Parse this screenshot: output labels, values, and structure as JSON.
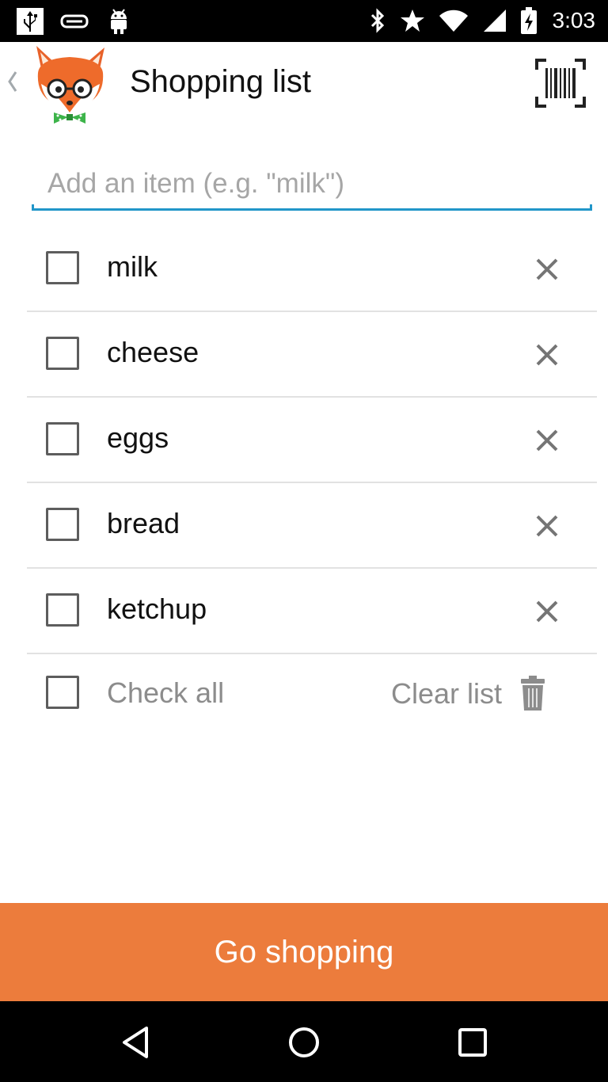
{
  "status_bar": {
    "time": "3:03",
    "left_icons": [
      "usb-icon",
      "cast-icon",
      "android-debug-icon"
    ],
    "right_icons": [
      "bluetooth-icon",
      "star-icon",
      "wifi-icon",
      "cell-signal-icon",
      "battery-charging-icon"
    ]
  },
  "header": {
    "title": "Shopping list",
    "back_icon": "chevron-left-icon",
    "logo": "fox-mascot",
    "scan_icon": "barcode-scan-icon"
  },
  "add_item": {
    "placeholder": "Add an item (e.g. \"milk\")",
    "value": ""
  },
  "items": [
    {
      "label": "milk",
      "checked": false
    },
    {
      "label": "cheese",
      "checked": false
    },
    {
      "label": "eggs",
      "checked": false
    },
    {
      "label": "bread",
      "checked": false
    },
    {
      "label": "ketchup",
      "checked": false
    }
  ],
  "footer": {
    "check_all_label": "Check all",
    "clear_list_label": "Clear list",
    "trash_icon": "trash-icon"
  },
  "primary_action": {
    "label": "Go shopping"
  },
  "colors": {
    "accent_orange": "#ec7c3c",
    "input_underline": "#2196c9",
    "secondary_text": "#8c8c8c"
  },
  "nav_bar": {
    "icons": [
      "back-triangle-icon",
      "home-circle-icon",
      "recents-square-icon"
    ]
  }
}
